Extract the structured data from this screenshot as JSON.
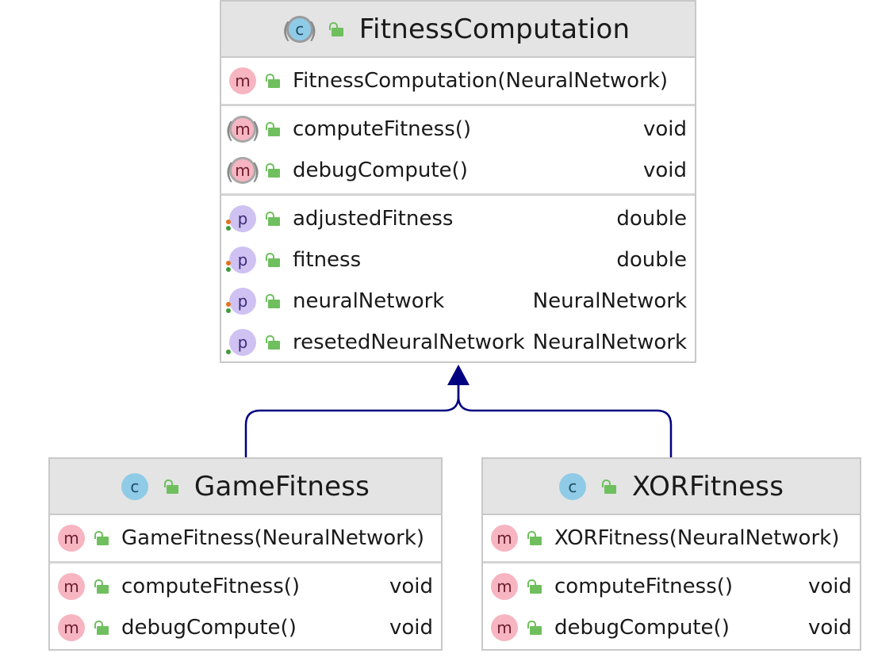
{
  "classes": {
    "fitness_computation": {
      "name": "FitnessComputation",
      "kind_icon": "class-c-icon",
      "constructor": "FitnessComputation(NeuralNetwork)",
      "methods": [
        {
          "name": "computeFitness()",
          "type": "void",
          "abstract": true
        },
        {
          "name": "debugCompute()",
          "type": "void",
          "abstract": true
        }
      ],
      "properties": [
        {
          "name": "adjustedFitness",
          "type": "double",
          "setter": true
        },
        {
          "name": "fitness",
          "type": "double",
          "setter": true
        },
        {
          "name": "neuralNetwork",
          "type": "NeuralNetwork",
          "setter": true
        },
        {
          "name": "resetedNeuralNetwork",
          "type": "NeuralNetwork",
          "setter": false
        }
      ]
    },
    "game_fitness": {
      "name": "GameFitness",
      "kind_icon": "class-c-icon",
      "constructor": "GameFitness(NeuralNetwork)",
      "methods": [
        {
          "name": "computeFitness()",
          "type": "void"
        },
        {
          "name": "debugCompute()",
          "type": "void"
        }
      ]
    },
    "xor_fitness": {
      "name": "XORFitness",
      "kind_icon": "class-c-icon",
      "constructor": "XORFitness(NeuralNetwork)",
      "methods": [
        {
          "name": "computeFitness()",
          "type": "void"
        },
        {
          "name": "debugCompute()",
          "type": "void"
        }
      ]
    }
  },
  "icons": {
    "class": "c",
    "method": "m",
    "property": "p"
  },
  "colors": {
    "inheritance_arrow": "#000080",
    "class_badge": "#8fcbe6",
    "method_badge": "#f6b5c1",
    "property_badge": "#cfc2f2",
    "public_lock": "#6fbf5e"
  },
  "relations": [
    {
      "from": "GameFitness",
      "to": "FitnessComputation",
      "kind": "inheritance"
    },
    {
      "from": "XORFitness",
      "to": "FitnessComputation",
      "kind": "inheritance"
    }
  ]
}
